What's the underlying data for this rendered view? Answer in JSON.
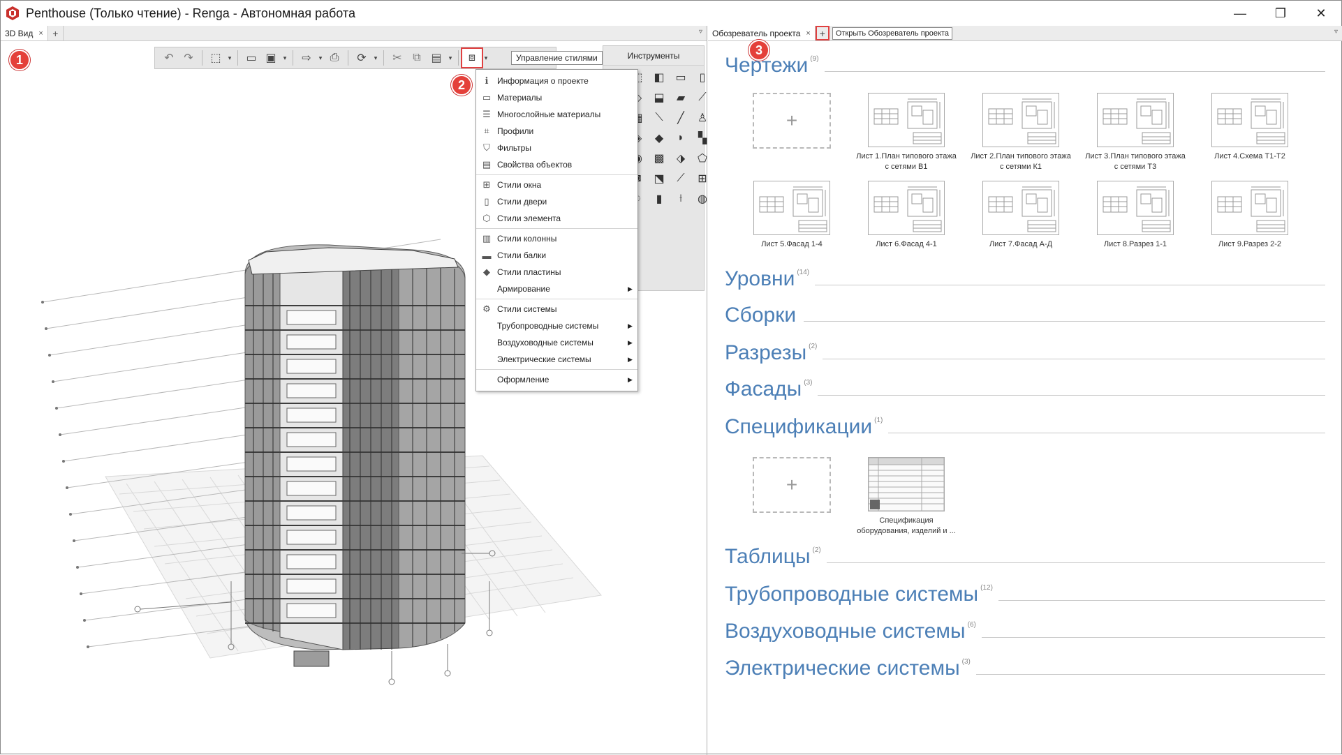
{
  "window": {
    "title": "Penthouse (Только чтение) - Renga - Автономная работа",
    "minimize": "—",
    "maximize": "❐",
    "close": "✕"
  },
  "left": {
    "tab_label": "3D Вид",
    "tab_close": "×",
    "tab_add": "+",
    "tab_dropdown": "▿",
    "badge": "1",
    "badge2": "2",
    "tooltip": "Управление стилями",
    "instruments_title": "Инструменты",
    "menu": [
      {
        "icon": "project-info-icon",
        "glyph": "ℹ",
        "label": "Информация о проекте",
        "submenu": false
      },
      {
        "icon": "materials-icon",
        "glyph": "▭",
        "label": "Материалы",
        "submenu": false
      },
      {
        "icon": "layered-materials-icon",
        "glyph": "☰",
        "label": "Многослойные материалы",
        "submenu": false
      },
      {
        "icon": "profiles-icon",
        "glyph": "⌗",
        "label": "Профили",
        "submenu": false
      },
      {
        "icon": "filters-icon",
        "glyph": "⛉",
        "label": "Фильтры",
        "submenu": false
      },
      {
        "icon": "object-properties-icon",
        "glyph": "▤",
        "label": "Свойства объектов",
        "submenu": false,
        "sep_after": true
      },
      {
        "icon": "window-styles-icon",
        "glyph": "⊞",
        "label": "Стили окна",
        "submenu": false
      },
      {
        "icon": "door-styles-icon",
        "glyph": "▯",
        "label": "Стили двери",
        "submenu": false
      },
      {
        "icon": "element-styles-icon",
        "glyph": "⬡",
        "label": "Стили элемента",
        "submenu": false,
        "sep_after": true
      },
      {
        "icon": "column-styles-icon",
        "glyph": "▥",
        "label": "Стили колонны",
        "submenu": false
      },
      {
        "icon": "beam-styles-icon",
        "glyph": "▬",
        "label": "Стили балки",
        "submenu": false
      },
      {
        "icon": "plate-styles-icon",
        "glyph": "◆",
        "label": "Стили пластины",
        "submenu": false
      },
      {
        "icon": "reinforcement-icon",
        "glyph": "",
        "label": "Армирование",
        "submenu": true,
        "sep_after": true
      },
      {
        "icon": "system-styles-icon",
        "glyph": "⚙",
        "label": "Стили системы",
        "submenu": false
      },
      {
        "icon": "pipe-systems-icon",
        "glyph": "",
        "label": "Трубопроводные системы",
        "submenu": true
      },
      {
        "icon": "duct-systems-icon",
        "glyph": "",
        "label": "Воздуховодные системы",
        "submenu": true
      },
      {
        "icon": "electrical-systems-icon",
        "glyph": "",
        "label": "Электрические системы",
        "submenu": true,
        "sep_after": true
      },
      {
        "icon": "appearance-icon",
        "glyph": "",
        "label": "Оформление",
        "submenu": true
      }
    ]
  },
  "right": {
    "tab_label": "Обозреватель проекта",
    "tab_close": "×",
    "tab_add": "+",
    "tooltip": "Открыть Обозреватель проекта",
    "tab_dropdown": "▿",
    "badge": "3",
    "sections": [
      {
        "key": "drawings",
        "title": "Чертежи",
        "count": "(9)"
      },
      {
        "key": "levels",
        "title": "Уровни",
        "count": "(14)"
      },
      {
        "key": "assemblies",
        "title": "Сборки",
        "count": ""
      },
      {
        "key": "sections",
        "title": "Разрезы",
        "count": "(2)"
      },
      {
        "key": "facades",
        "title": "Фасады",
        "count": "(3)"
      },
      {
        "key": "specifications",
        "title": "Спецификации",
        "count": "(1)"
      },
      {
        "key": "tables",
        "title": "Таблицы",
        "count": "(2)"
      },
      {
        "key": "pipe",
        "title": "Трубопроводные системы",
        "count": "(12)"
      },
      {
        "key": "duct",
        "title": "Воздуховодные системы",
        "count": "(6)"
      },
      {
        "key": "electric",
        "title": "Электрические системы",
        "count": "(3)"
      }
    ],
    "add_glyph": "+",
    "sheets": [
      {
        "caption": "Лист 1.План типового этажа с сетями В1"
      },
      {
        "caption": "Лист 2.План типового этажа с сетями К1"
      },
      {
        "caption": "Лист 3.План типового этажа с сетями Т3"
      },
      {
        "caption": "Лист 4.Схема Т1-Т2"
      },
      {
        "caption": "Лист 5.Фасад 1-4"
      },
      {
        "caption": "Лист 6.Фасад 4-1"
      },
      {
        "caption": "Лист 7.Фасад А-Д"
      },
      {
        "caption": "Лист 8.Разрез 1-1"
      },
      {
        "caption": "Лист 9.Разрез 2-2"
      }
    ],
    "spec_caption": "Спецификация оборудования, изделий и ..."
  },
  "colors": {
    "accent_link": "#4c7fb6",
    "highlight_red": "#e04040",
    "badge_red": "#e4403a"
  }
}
